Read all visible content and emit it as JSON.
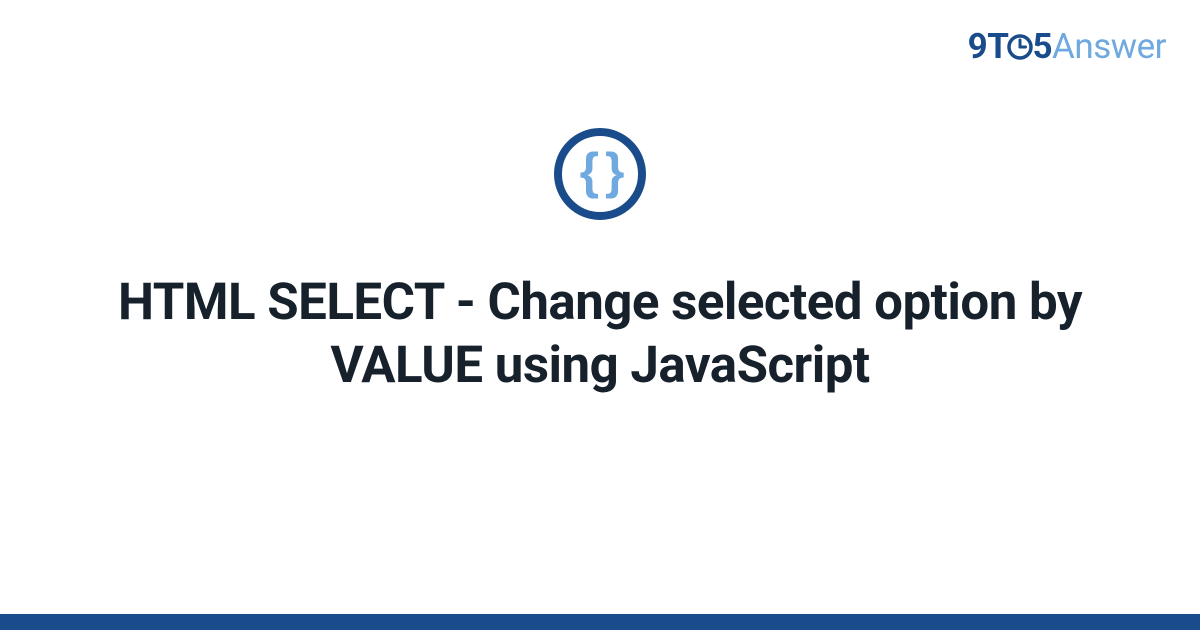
{
  "logo": {
    "part1": "9",
    "part2": "T",
    "part3": "5",
    "part4": "Answer"
  },
  "badge": {
    "symbol": "{ }"
  },
  "title": "HTML SELECT - Change selected option by VALUE using JavaScript",
  "colors": {
    "brand_dark": "#1a4c8b",
    "brand_light": "#6fa9e0",
    "text": "#16212c"
  }
}
